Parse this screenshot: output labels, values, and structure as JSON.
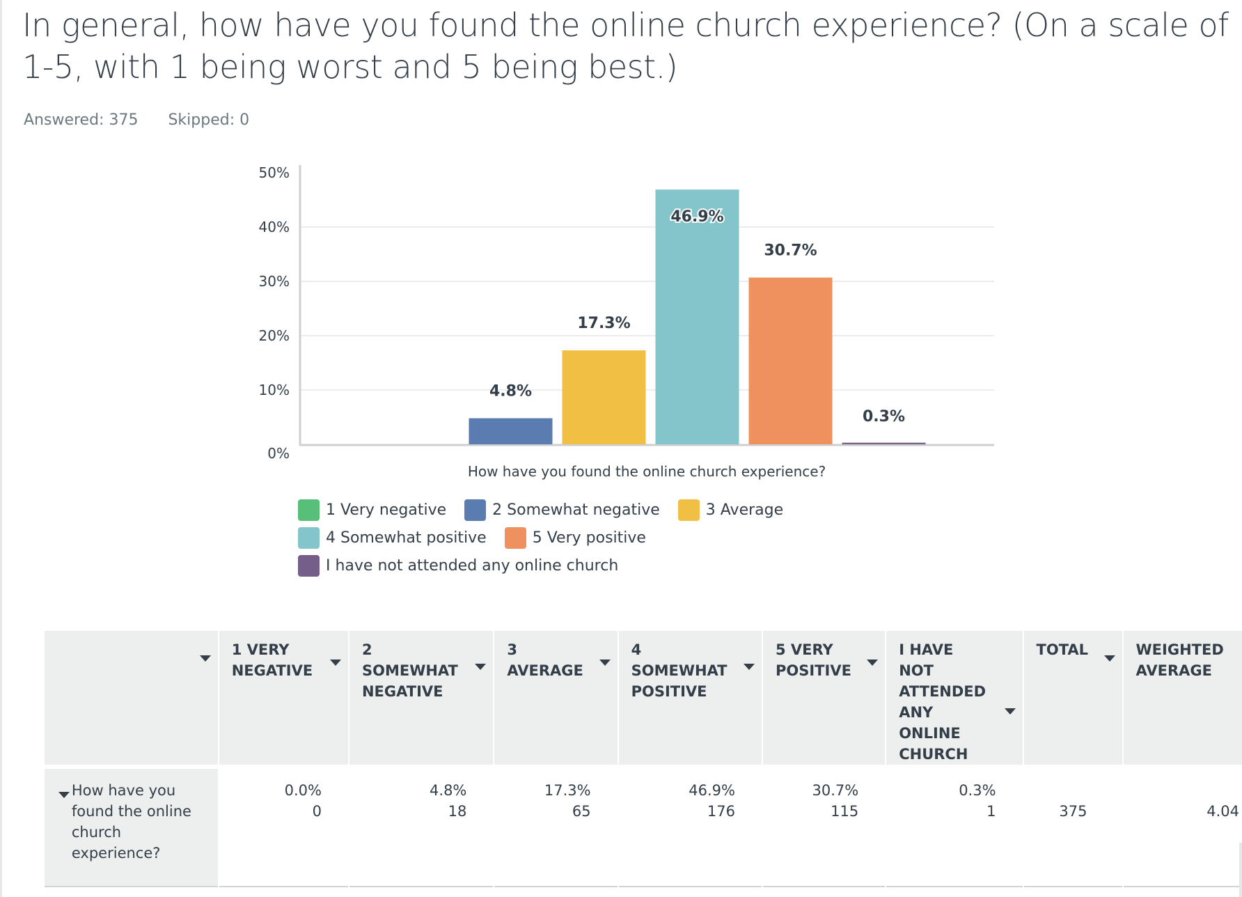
{
  "question": {
    "title": "In general, how have you found the online church experience? (On a scale of 1-5, with 1 being worst and 5 being best.)",
    "answered_label": "Answered: 375",
    "skipped_label": "Skipped: 0"
  },
  "chart_data": {
    "type": "bar",
    "title": "",
    "xlabel": "How have you found the online church experience?",
    "ylabel": "",
    "ylim": [
      0,
      50
    ],
    "yticks": [
      0,
      10,
      20,
      30,
      40,
      50
    ],
    "ytick_labels": [
      "0%",
      "10%",
      "20%",
      "30%",
      "40%",
      "50%"
    ],
    "grid": true,
    "legend_position": "bottom-left",
    "categories": [
      "How have you found the online church experience?"
    ],
    "series": [
      {
        "name": "1 Very negative",
        "color": "#57bf79",
        "values": [
          0.0
        ],
        "label": ""
      },
      {
        "name": "2 Somewhat negative",
        "color": "#5a7cb0",
        "values": [
          4.8
        ],
        "label": "4.8%"
      },
      {
        "name": "3 Average",
        "color": "#f0bf43",
        "values": [
          17.3
        ],
        "label": "17.3%"
      },
      {
        "name": "4 Somewhat positive",
        "color": "#83c5ca",
        "values": [
          46.9
        ],
        "label": "46.9%"
      },
      {
        "name": "5 Very positive",
        "color": "#ef905f",
        "values": [
          30.7
        ],
        "label": "30.7%"
      },
      {
        "name": "I have not attended any online church",
        "color": "#765e8a",
        "values": [
          0.3
        ],
        "label": "0.3%"
      }
    ]
  },
  "legend": {
    "rows": [
      [
        {
          "label": "1 Very negative",
          "color": "#57bf79"
        },
        {
          "label": "2 Somewhat negative",
          "color": "#5a7cb0"
        },
        {
          "label": "3 Average",
          "color": "#f0bf43"
        }
      ],
      [
        {
          "label": "4 Somewhat positive",
          "color": "#83c5ca"
        },
        {
          "label": "5 Very positive",
          "color": "#ef905f"
        }
      ],
      [
        {
          "label": "I have not attended any online church",
          "color": "#765e8a"
        }
      ]
    ]
  },
  "table": {
    "headers": [
      "",
      "1 Very negative",
      "2 Somewhat negative",
      "3 Average",
      "4 Somewhat positive",
      "5 Very positive",
      "I have not attended any online church",
      "Total",
      "Weighted average"
    ],
    "rows": [
      {
        "label": "How have you found the online church experience?",
        "cells": [
          {
            "pct": "0.0%",
            "count": "0"
          },
          {
            "pct": "4.8%",
            "count": "18"
          },
          {
            "pct": "17.3%",
            "count": "65"
          },
          {
            "pct": "46.9%",
            "count": "176"
          },
          {
            "pct": "30.7%",
            "count": "115"
          },
          {
            "pct": "0.3%",
            "count": "1"
          }
        ],
        "total": "375",
        "weighted_average": "4.04"
      }
    ]
  }
}
